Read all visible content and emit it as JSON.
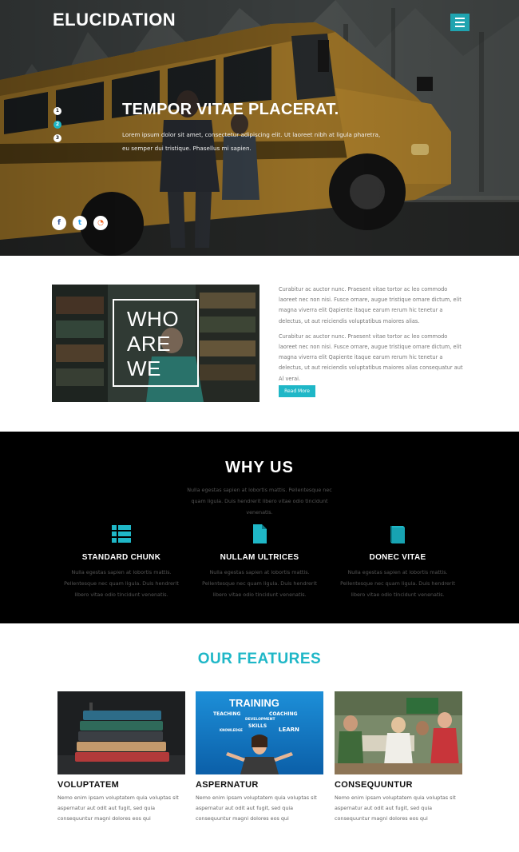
{
  "header": {
    "logo": "ELUCIDATION",
    "menu_icon": "hamburger-menu-icon"
  },
  "hero": {
    "slide_numbers": [
      "1",
      "2",
      "3"
    ],
    "active_slide": 2,
    "title": "TEMPOR VITAE PLACERAT.",
    "text": "Lorem ipsum dolor sit amet, consectetur adipiscing elit. Ut laoreet nibh at ligula pharetra, eu semper dui tristique. Phasellus mi sapien.",
    "social": [
      {
        "icon": "facebook-icon",
        "glyph": "f"
      },
      {
        "icon": "twitter-icon",
        "glyph": "t"
      },
      {
        "icon": "rss-icon",
        "glyph": "◔"
      }
    ]
  },
  "who": {
    "lines": [
      "WHO",
      "ARE",
      "WE"
    ],
    "paragraphs": [
      "Curabitur ac auctor nunc. Praesent vitae tortor ac leo commodo laoreet nec non nisi. Fusce ornare, augue tristique ornare dictum, elit magna viverra elit Qapiente itaque earum rerum hic tenetur a delectus, ut aut reiciendis voluptatibus maiores alias.",
      "Curabitur ac auctor nunc. Praesent vitae tortor ac leo commodo laoreet nec non nisi. Fusce ornare, augue tristique ornare dictum, elit magna viverra elit Qapiente itaque earum rerum hic tenetur a delectus, ut aut reiciendis voluptatibus maiores alias consequatur aut Al verai."
    ],
    "read_more": "Read More"
  },
  "why": {
    "title": "WHY US",
    "subtitle": "Nulla egestas sapien at lobortis mattis. Pellentesque nec quam ligula. Duis hendrerit libero vitae odio tincidunt venenatis.",
    "items": [
      {
        "icon": "list-icon",
        "title": "STANDARD CHUNK",
        "text": "Nulla egestas sapien at lobortis mattis. Pellentesque nec quam ligula. Duis hendrerit libero vitae odio tincidunt venenatis."
      },
      {
        "icon": "file-icon",
        "title": "NULLAM ULTRICES",
        "text": "Nulla egestas sapien at lobortis mattis. Pellentesque nec quam ligula. Duis hendrerit libero vitae odio tincidunt venenatis."
      },
      {
        "icon": "book-icon",
        "title": "DONEC VITAE",
        "text": "Nulla egestas sapien at lobortis mattis. Pellentesque nec quam ligula. Duis hendrerit libero vitae odio tincidunt venenatis."
      }
    ]
  },
  "features": {
    "title": "OUR FEATURES",
    "items": [
      {
        "title": "VOLUPTATEM",
        "text": "Nemo enim ipsam voluptatem quia voluptas sit aspernatur aut odit aut fugit, sed quia consequuntur magni dolores eos qui"
      },
      {
        "title": "ASPERNATUR",
        "text": "Nemo enim ipsam voluptatem quia voluptas sit aspernatur aut odit aut fugit, sed quia consequuntur magni dolores eos qui",
        "image_text": {
          "main": "TRAINING",
          "words": [
            "TEACHING",
            "COACHING",
            "DEVELOPMENT",
            "SKILLS",
            "KNOWLEDGE",
            "LEARN"
          ]
        }
      },
      {
        "title": "CONSEQUUNTUR",
        "text": "Nemo enim ipsam voluptatem quia voluptas sit aspernatur aut odit aut fugit, sed quia consequuntur magni dolores eos qui"
      }
    ]
  },
  "colors": {
    "accent": "#1fb7c7",
    "dark": "#000000"
  }
}
